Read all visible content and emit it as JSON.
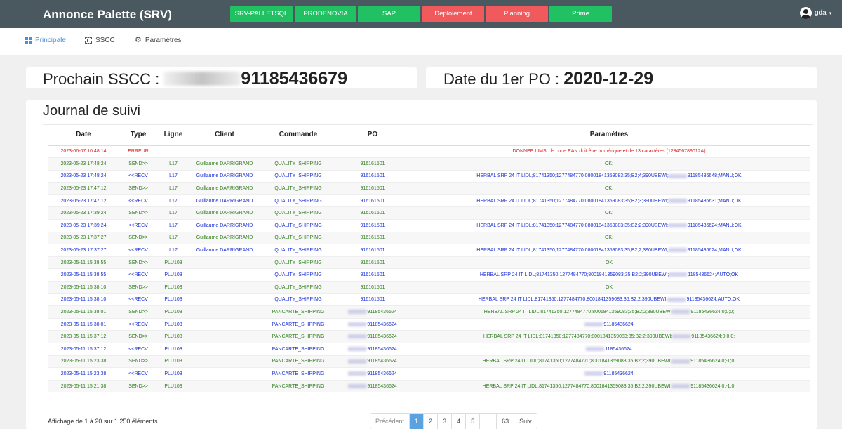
{
  "header": {
    "title": "Annonce Palette (SRV)",
    "env_buttons": [
      {
        "label": "SRV-PALLETSQL",
        "color": "#21c163"
      },
      {
        "label": "PRODENOVIA",
        "color": "#21c163"
      },
      {
        "label": "SAP",
        "color": "#21c163"
      },
      {
        "label": "Deploiement",
        "color": "#f15a5d"
      },
      {
        "label": "Planning",
        "color": "#f15a5d"
      },
      {
        "label": "Prime",
        "color": "#21c163"
      }
    ],
    "user": "gda",
    "user_icon": "user-avatar-icon",
    "caret_icon": "caret-down-icon",
    "caret": "▾"
  },
  "nav": {
    "items": [
      {
        "label": "Principale",
        "icon": "grid-icon",
        "active": true
      },
      {
        "label": "SSCC",
        "icon": "barcode-scan-icon",
        "active": false
      },
      {
        "label": "Paramètres",
        "icon": "gear-icon",
        "active": false
      }
    ]
  },
  "sscc": {
    "label": "Prochain SSCC :",
    "value": "91185436679"
  },
  "po": {
    "label": "Date du 1er PO :",
    "value": "2020-12-29"
  },
  "journal": {
    "title": "Journal de suivi",
    "columns": [
      "Date",
      "Type",
      "Ligne",
      "Client",
      "Commande",
      "PO",
      "Paramètres"
    ],
    "rows": [
      {
        "date": "2023-06-07 10:48:14",
        "type": "ERREUR",
        "ligne": "",
        "client": "",
        "commande": "",
        "po": "",
        "po_blur": false,
        "params": "DONNEE LIMS : le code EAN doit être numérique et de 13 caractères (123456789012A)",
        "params_pre": "",
        "params_blur": false,
        "params_post": "",
        "kind": "err"
      },
      {
        "date": "2023-05-23 17:48:24",
        "type": "SEND>>",
        "ligne": "L17",
        "client": "Guillaume DARRIGRAND",
        "commande": "QUALITY_SHIPPING",
        "po": "916161501",
        "po_blur": false,
        "params": "",
        "params_pre": "OK;",
        "params_blur": false,
        "params_post": "",
        "kind": "send"
      },
      {
        "date": "2023-05-23 17:48:24",
        "type": "<<RECV",
        "ligne": "L17",
        "client": "Guillaume DARRIGRAND",
        "commande": "QUALITY_SHIPPING",
        "po": "916161501",
        "po_blur": false,
        "params": "",
        "params_pre": "HERBAL SRP 24 IT LIDL;81741350;1277484770;08001841359083;35;B2;4;390UBEWI;",
        "params_blur": true,
        "params_post": "91185436648;MANU;OK",
        "kind": "recv"
      },
      {
        "date": "2023-05-23 17:47:12",
        "type": "SEND>>",
        "ligne": "L17",
        "client": "Guillaume DARRIGRAND",
        "commande": "QUALITY_SHIPPING",
        "po": "916161501",
        "po_blur": false,
        "params": "",
        "params_pre": "OK;",
        "params_blur": false,
        "params_post": "",
        "kind": "send"
      },
      {
        "date": "2023-05-23 17:47:12",
        "type": "<<RECV",
        "ligne": "L17",
        "client": "Guillaume DARRIGRAND",
        "commande": "QUALITY_SHIPPING",
        "po": "916161501",
        "po_blur": false,
        "params": "",
        "params_pre": "HERBAL SRP 24 IT LIDL;81741350;1277484770;08001841359083;35;B2;3;390UBEWI;",
        "params_blur": true,
        "params_post": "91185436631;MANU;OK",
        "kind": "recv"
      },
      {
        "date": "2023-05-23 17:39:24",
        "type": "SEND>>",
        "ligne": "L17",
        "client": "Guillaume DARRIGRAND",
        "commande": "QUALITY_SHIPPING",
        "po": "916161501",
        "po_blur": false,
        "params": "",
        "params_pre": "OK;",
        "params_blur": false,
        "params_post": "",
        "kind": "send"
      },
      {
        "date": "2023-05-23 17:39:24",
        "type": "<<RECV",
        "ligne": "L17",
        "client": "Guillaume DARRIGRAND",
        "commande": "QUALITY_SHIPPING",
        "po": "916161501",
        "po_blur": false,
        "params": "",
        "params_pre": "HERBAL SRP 24 IT LIDL;81741350;1277484770;08001841359083;35;B2;2;390UBEWI;",
        "params_blur": true,
        "params_post": "91185436624;MANU;OK",
        "kind": "recv"
      },
      {
        "date": "2023-05-23 17:37:27",
        "type": "SEND>>",
        "ligne": "L17",
        "client": "Guillaume DARRIGRAND",
        "commande": "QUALITY_SHIPPING",
        "po": "916161501",
        "po_blur": false,
        "params": "",
        "params_pre": "OK;",
        "params_blur": false,
        "params_post": "",
        "kind": "send"
      },
      {
        "date": "2023-05-23 17:37:27",
        "type": "<<RECV",
        "ligne": "L17",
        "client": "Guillaume DARRIGRAND",
        "commande": "QUALITY_SHIPPING",
        "po": "916161501",
        "po_blur": false,
        "params": "",
        "params_pre": "HERBAL SRP 24 IT LIDL;81741350;1277484770;08001841359083;35;B2;2;390UBEWI;",
        "params_blur": true,
        "params_post": "91185436624;MANU;OK",
        "kind": "recv"
      },
      {
        "date": "2023-05-11 15:38:55",
        "type": "SEND>>",
        "ligne": "PLU103",
        "client": "",
        "commande": "QUALITY_SHIPPING",
        "po": "916161501",
        "po_blur": false,
        "params": "",
        "params_pre": "OK",
        "params_blur": false,
        "params_post": "",
        "kind": "send"
      },
      {
        "date": "2023-05-11 15:38:55",
        "type": "<<RECV",
        "ligne": "PLU103",
        "client": "",
        "commande": "QUALITY_SHIPPING",
        "po": "916161501",
        "po_blur": false,
        "params": "",
        "params_pre": "HERBAL SRP 24 IT LIDL;81741350;1277484770;8001841359083;35;B2;2;390UBEWI;",
        "params_blur": true,
        "params_post": "1185436624;AUTO;OK",
        "kind": "recv"
      },
      {
        "date": "2023-05-11 15:38:10",
        "type": "SEND>>",
        "ligne": "PLU103",
        "client": "",
        "commande": "QUALITY_SHIPPING",
        "po": "916161501",
        "po_blur": false,
        "params": "",
        "params_pre": "OK",
        "params_blur": false,
        "params_post": "",
        "kind": "send"
      },
      {
        "date": "2023-05-11 15:38:10",
        "type": "<<RECV",
        "ligne": "PLU103",
        "client": "",
        "commande": "QUALITY_SHIPPING",
        "po": "916161501",
        "po_blur": false,
        "params": "",
        "params_pre": "HERBAL SRP 24 IT LIDL;81741350;1277484770;8001841359083;35;B2;2;390UBEWI;",
        "params_blur": true,
        "params_post": "91185436624;AUTO;OK",
        "kind": "recv"
      },
      {
        "date": "2023-05-11 15:38:01",
        "type": "SEND>>",
        "ligne": "PLU103",
        "client": "",
        "commande": "PANCARTE_SHIPPING",
        "po": "91185436624",
        "po_blur": true,
        "params": "",
        "params_pre": "HERBAL SRP 24 IT LIDL;81741350;1277484770;8001841359083;35;B2;2;390UBEWI",
        "params_blur": true,
        "params_post": "91185436624;0;0;0;",
        "kind": "send"
      },
      {
        "date": "2023-05-11 15:38:01",
        "type": "<<RECV",
        "ligne": "PLU103",
        "client": "",
        "commande": "PANCARTE_SHIPPING",
        "po": "91185436624",
        "po_blur": true,
        "params": "",
        "params_pre": "",
        "params_blur": true,
        "params_post": "91185436624",
        "kind": "recv"
      },
      {
        "date": "2023-05-11 15:37:12",
        "type": "SEND>>",
        "ligne": "PLU103",
        "client": "",
        "commande": "PANCARTE_SHIPPING",
        "po": "91185436624",
        "po_blur": true,
        "params": "",
        "params_pre": "HERBAL SRP 24 IT LIDL;81741350;1277484770;8001841359083;35;B2;2;390UBEWI;",
        "params_blur": true,
        "params_post": "91185436624;0;0;0;",
        "kind": "send"
      },
      {
        "date": "2023-05-11 15:37:12",
        "type": "<<RECV",
        "ligne": "PLU103",
        "client": "",
        "commande": "PANCARTE_SHIPPING",
        "po": "91185436624",
        "po_blur": true,
        "params": "",
        "params_pre": "",
        "params_blur": true,
        "params_post": "1185436624",
        "kind": "recv"
      },
      {
        "date": "2023-05-11 15:23:38",
        "type": "SEND>>",
        "ligne": "PLU103",
        "client": "",
        "commande": "PANCARTE_SHIPPING",
        "po": "91185436624",
        "po_blur": true,
        "params": "",
        "params_pre": "HERBAL SRP 24 IT LIDL;81741350;1277484770;8001841359083;35;B2;2;390UBEWI;",
        "params_blur": true,
        "params_post": "91185436624;0;-1;0;",
        "kind": "send"
      },
      {
        "date": "2023-05-11 15:23:38",
        "type": "<<RECV",
        "ligne": "PLU103",
        "client": "",
        "commande": "PANCARTE_SHIPPING",
        "po": "91185436624",
        "po_blur": true,
        "params": "",
        "params_pre": "",
        "params_blur": true,
        "params_post": "91185436624",
        "kind": "recv"
      },
      {
        "date": "2023-05-11 15:21:38",
        "type": "SEND>>",
        "ligne": "PLU103",
        "client": "",
        "commande": "PANCARTE_SHIPPING",
        "po": "91185436624",
        "po_blur": true,
        "params": "",
        "params_pre": "HERBAL SRP 24 IT LIDL;81741350;1277484770;8001841359083;35;B2;2;390UBEWI;",
        "params_blur": true,
        "params_post": "91185436624;0;-1;0;",
        "kind": "send"
      }
    ]
  },
  "footer": {
    "info": "Affichage de 1 à 20 sur 1.250 éléments",
    "pages": [
      "Précédent",
      "1",
      "2",
      "3",
      "4",
      "5",
      "…",
      "63",
      "Suiv"
    ],
    "active_page": "1"
  }
}
